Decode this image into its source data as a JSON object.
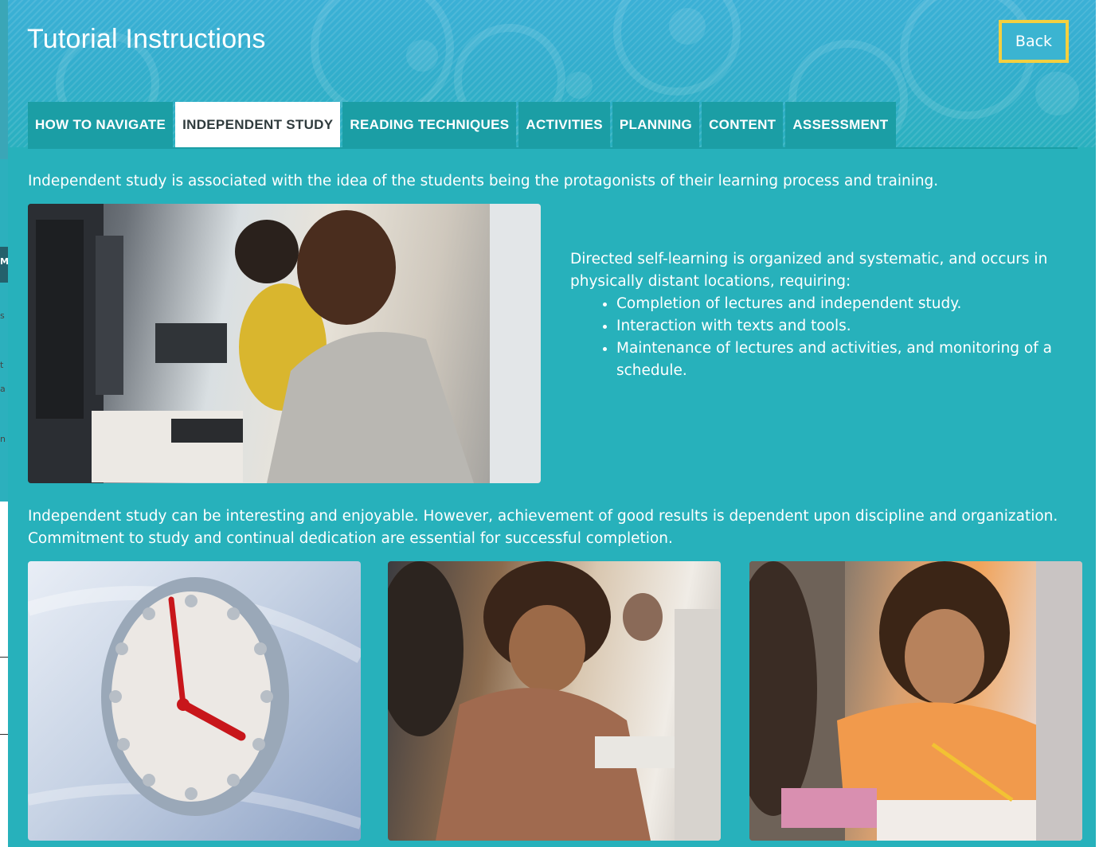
{
  "header": {
    "title": "Tutorial Instructions",
    "back_label": "Back"
  },
  "tabs": [
    {
      "label": "HOW TO NAVIGATE",
      "active": false
    },
    {
      "label": "INDEPENDENT STUDY",
      "active": true
    },
    {
      "label": "READING TECHNIQUES",
      "active": false
    },
    {
      "label": "ACTIVITIES",
      "active": false
    },
    {
      "label": "PLANNING",
      "active": false
    },
    {
      "label": "CONTENT",
      "active": false
    },
    {
      "label": "ASSESSMENT",
      "active": false
    }
  ],
  "content": {
    "intro": "Independent study is associated with the idea of the students being the protagonists of their learning process and training.",
    "side_text": "Directed self-learning is organized and systematic, and occurs in physically distant locations, requiring:",
    "bullets": [
      "Completion of lectures and independent study.",
      "Interaction with texts and tools.",
      "Maintenance of lectures and activities, and monitoring of a schedule."
    ],
    "paragraph2": "Independent study can be interesting and enjoyable. However, achievement of good results is dependent upon discipline and organization. Commitment to study and continual dedication are essential for successful completion."
  },
  "background_glyphs": [
    "s",
    "M",
    "t",
    "a",
    "n"
  ],
  "colors": {
    "panel": "#27b1bb",
    "header": "#3bb0d6",
    "tab": "#1b9ea5",
    "tab_active": "#ffffff",
    "back_border": "#f4d03f"
  }
}
